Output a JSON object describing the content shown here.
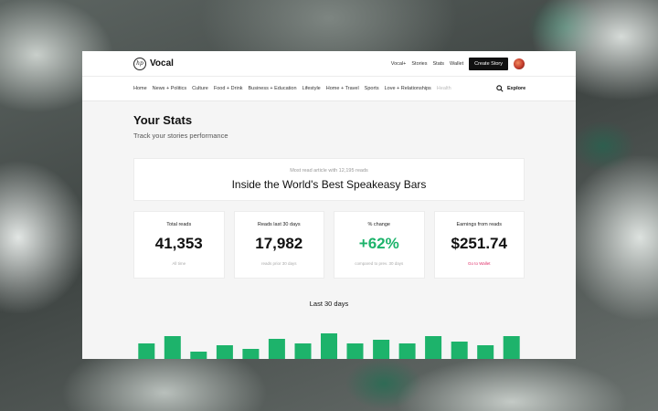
{
  "header": {
    "logo_mark": "hp",
    "logo_text": "Vocal",
    "links": [
      "Vocal+",
      "Stories",
      "Stats",
      "Wallet"
    ],
    "create_label": "Create Story"
  },
  "nav": {
    "items": [
      "Home",
      "News + Politics",
      "Culture",
      "Food + Drink",
      "Business + Education",
      "Lifestyle",
      "Home + Travel",
      "Sports",
      "Love + Relationships",
      "Health"
    ],
    "explore_label": "Explore"
  },
  "main": {
    "title": "Your Stats",
    "subtitle": "Track your stories performance",
    "top_article": {
      "caption": "Most read article with 12,195 reads",
      "title": "Inside the World's Best Speakeasy Bars"
    },
    "stats": [
      {
        "label": "Total reads",
        "value": "41,353",
        "note": "All time"
      },
      {
        "label": "Reads last 30 days",
        "value": "17,982",
        "note": "reads prior 30 days"
      },
      {
        "label": "% change",
        "value": "+62%",
        "note": "compared to prev. 30 days"
      },
      {
        "label": "Earnings from reads",
        "value": "$251.74",
        "note": "Go to Wallet"
      }
    ]
  },
  "colors": {
    "accent_green": "#1db36b",
    "link_pink": "#e0306a"
  },
  "chart_data": {
    "type": "bar",
    "title": "Last 30 days",
    "values": [
      20,
      28,
      11,
      18,
      14,
      25,
      20,
      31,
      20,
      24,
      20,
      28,
      22,
      18,
      28
    ],
    "ylim": [
      0,
      40
    ],
    "color": "#1db36b"
  }
}
